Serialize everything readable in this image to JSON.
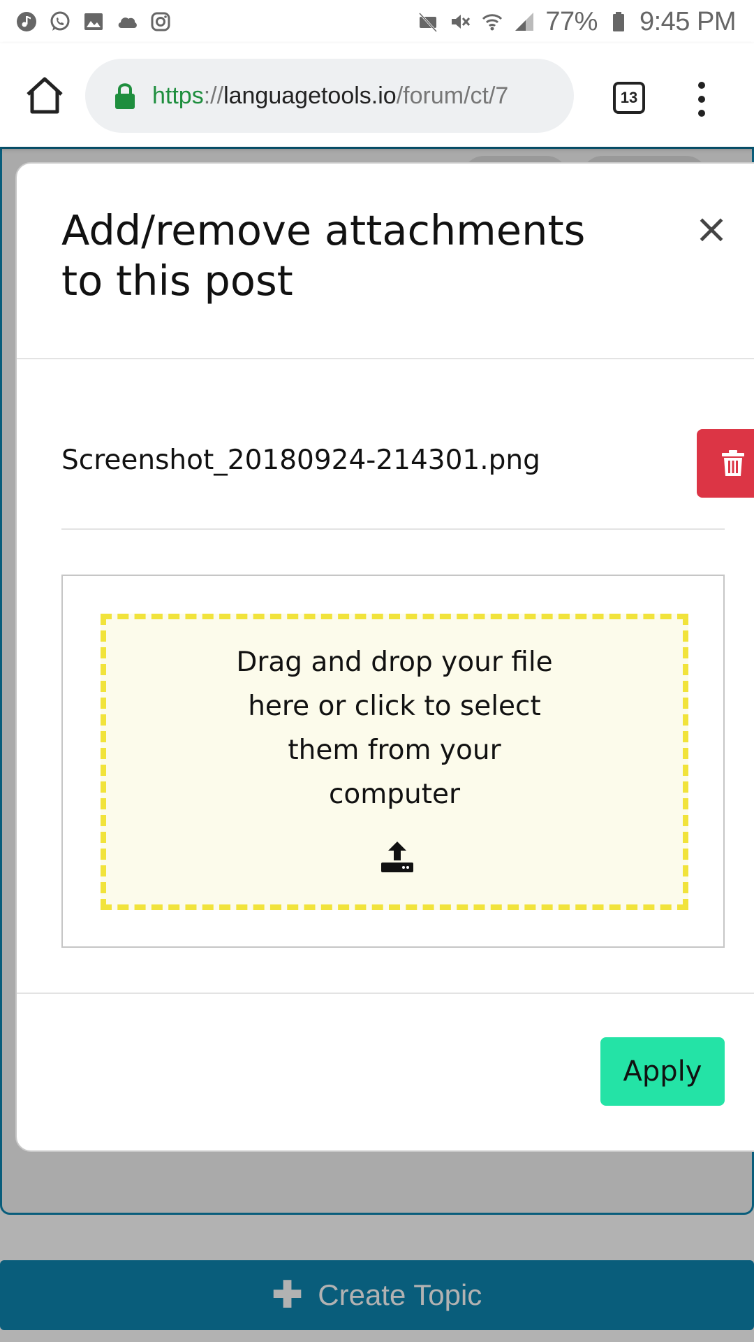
{
  "status_bar": {
    "battery_percent": "77%",
    "time": "9:45 PM",
    "left_icons": [
      "music-icon",
      "whatsapp-icon",
      "gallery-icon",
      "cloud-icon",
      "instagram-icon"
    ],
    "right_icons": [
      "no-sim-icon",
      "mute-icon",
      "wifi-icon",
      "signal-icon",
      "battery-icon"
    ]
  },
  "browser": {
    "url_scheme": "https",
    "url_separator": "://",
    "url_host": "languagetools.io",
    "url_path": "/forum/ct/7",
    "tab_count": "13",
    "colors": {
      "secure_green": "#1e8e3e"
    }
  },
  "modal": {
    "title": "Add/remove attachments to this post",
    "close_symbol": "×",
    "attachments": [
      {
        "file_name": "Screenshot_20180924-214301.png",
        "delete_icon": "trash-icon"
      }
    ],
    "dropzone_text": "Drag and drop your file here or click to select them from your computer",
    "upload_icon": "upload-icon",
    "apply_label": "Apply",
    "colors": {
      "delete": "#dc3545",
      "apply": "#24e3a6",
      "dropzone_border": "#f1e33b"
    }
  },
  "page": {
    "create_topic_symbol": "✚",
    "create_topic_label": "Create Topic",
    "colors": {
      "primary": "#0e86b0"
    }
  }
}
